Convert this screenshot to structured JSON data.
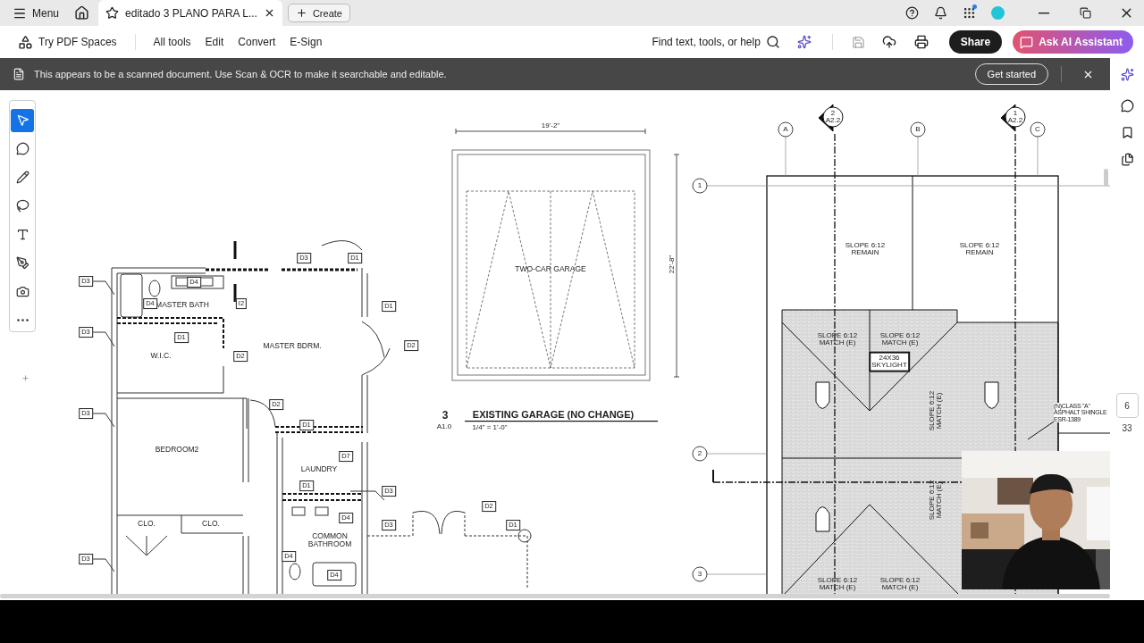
{
  "title_bar": {
    "menu": "Menu",
    "tabs": [
      {
        "title": "editado 3 PLANO PARA L...",
        "selected": true
      }
    ],
    "create": "Create",
    "notification_dot": true
  },
  "toolbar": {
    "spaces": "Try PDF Spaces",
    "items": [
      "All tools",
      "Edit",
      "Convert",
      "E-Sign"
    ],
    "search": "Find text, tools, or help",
    "share": "Share",
    "assistant": "Ask AI Assistant"
  },
  "banner": {
    "message": "This appears to be a scanned document. Use Scan & OCR to make it searchable and editable.",
    "action": "Get started"
  },
  "tools": [
    {
      "kind": "select",
      "selected": true
    },
    {
      "kind": "comment",
      "selected": false
    },
    {
      "kind": "pen",
      "selected": false
    },
    {
      "kind": "lasso",
      "selected": false
    },
    {
      "kind": "text",
      "selected": false
    },
    {
      "kind": "sign",
      "selected": false
    },
    {
      "kind": "snapshot",
      "selected": false
    },
    {
      "kind": "more",
      "selected": false
    }
  ],
  "page": {
    "current": "6",
    "total": "33"
  },
  "drawing_labels": [
    {
      "lines": [
        "MASTER BATH"
      ],
      "kind": "room"
    },
    {
      "lines": [
        "MASTER BDRM."
      ],
      "kind": "room"
    },
    {
      "lines": [
        "W.I.C."
      ],
      "kind": "room"
    },
    {
      "lines": [
        "BEDROOM2"
      ],
      "kind": "room"
    },
    {
      "lines": [
        "CLO."
      ],
      "kind": "room"
    },
    {
      "lines": [
        "CLO."
      ],
      "kind": "room"
    },
    {
      "lines": [
        "LAUNDRY"
      ],
      "kind": "room"
    },
    {
      "lines": [
        "COMMON",
        "BATHROOM"
      ],
      "kind": "room"
    },
    {
      "lines": [
        "D3"
      ],
      "kind": "tag"
    },
    {
      "lines": [
        "D3"
      ],
      "kind": "tag"
    },
    {
      "lines": [
        "D3"
      ],
      "kind": "tag"
    },
    {
      "lines": [
        "D3"
      ],
      "kind": "tag"
    },
    {
      "lines": [
        "D4"
      ],
      "kind": "tag"
    },
    {
      "lines": [
        "D4"
      ],
      "kind": "tag"
    },
    {
      "lines": [
        "I2"
      ],
      "kind": "tag"
    },
    {
      "lines": [
        "D1"
      ],
      "kind": "tag"
    },
    {
      "lines": [
        "D2"
      ],
      "kind": "tag"
    },
    {
      "lines": [
        "D3"
      ],
      "kind": "tag"
    },
    {
      "lines": [
        "D1"
      ],
      "kind": "tag"
    },
    {
      "lines": [
        "D1"
      ],
      "kind": "tag"
    },
    {
      "lines": [
        "D2"
      ],
      "kind": "tag"
    },
    {
      "lines": [
        "D2"
      ],
      "kind": "tag"
    },
    {
      "lines": [
        "D1"
      ],
      "kind": "tag"
    },
    {
      "lines": [
        "D7"
      ],
      "kind": "tag"
    },
    {
      "lines": [
        "D1"
      ],
      "kind": "tag"
    },
    {
      "lines": [
        "D3"
      ],
      "kind": "tag"
    },
    {
      "lines": [
        "D4"
      ],
      "kind": "tag"
    },
    {
      "lines": [
        "D3"
      ],
      "kind": "tag"
    },
    {
      "lines": [
        "D4"
      ],
      "kind": "tag"
    },
    {
      "lines": [
        "D4"
      ],
      "kind": "tag"
    },
    {
      "lines": [
        "D2"
      ],
      "kind": "tag"
    },
    {
      "lines": [
        "D1"
      ],
      "kind": "tag"
    },
    {
      "lines": [
        "19'-2\""
      ],
      "kind": "small"
    },
    {
      "lines": [
        "22'-8\""
      ],
      "kind": "vertical"
    },
    {
      "lines": [
        "TWO-CAR GARAGE"
      ],
      "kind": "room"
    },
    {
      "lines": [
        "3"
      ],
      "kind": "number"
    },
    {
      "lines": [
        "A1.0"
      ],
      "kind": "small"
    },
    {
      "lines": [
        "EXISTING GARAGE (NO CHANGE)"
      ],
      "kind": "title"
    },
    {
      "lines": [
        "1/4\" = 1'-0\""
      ],
      "kind": "small"
    },
    {
      "lines": [
        "A"
      ],
      "kind": "bubble"
    },
    {
      "lines": [
        "B"
      ],
      "kind": "bubble"
    },
    {
      "lines": [
        "C"
      ],
      "kind": "bubble"
    },
    {
      "lines": [
        "1"
      ],
      "kind": "bubble"
    },
    {
      "lines": [
        "2"
      ],
      "kind": "bubble"
    },
    {
      "lines": [
        "3"
      ],
      "kind": "bubble"
    },
    {
      "lines": [
        "2",
        "A2.2"
      ],
      "kind": "section"
    },
    {
      "lines": [
        "1",
        "A2.2"
      ],
      "kind": "section"
    },
    {
      "lines": [
        "SLOPE 6:12",
        "REMAIN"
      ],
      "kind": "small"
    },
    {
      "lines": [
        "SLOPE 6:12",
        "REMAIN"
      ],
      "kind": "small"
    },
    {
      "lines": [
        "SLOPE 6:12",
        "MATCH (E)"
      ],
      "kind": "small"
    },
    {
      "lines": [
        "SLOPE 6:12",
        "MATCH (E)"
      ],
      "kind": "small"
    },
    {
      "lines": [
        "24X36",
        "SKYLIGHT"
      ],
      "kind": "skylight"
    },
    {
      "lines": [
        "SLOPE 6:12",
        "MATCH (E)"
      ],
      "kind": "vertical"
    },
    {
      "lines": [
        "SLOPE 6:12",
        "MATCH (E)"
      ],
      "kind": "vertical"
    },
    {
      "lines": [
        "(N)CLASS \"A\"",
        "ASPHALT SHINGLE",
        "ESR-1389"
      ],
      "kind": "left"
    },
    {
      "lines": [
        "SLOPE 6:12",
        "MATCH (E)"
      ],
      "kind": "small"
    },
    {
      "lines": [
        "SLOPE 6:12",
        "MATCH (E)"
      ],
      "kind": "small"
    }
  ]
}
